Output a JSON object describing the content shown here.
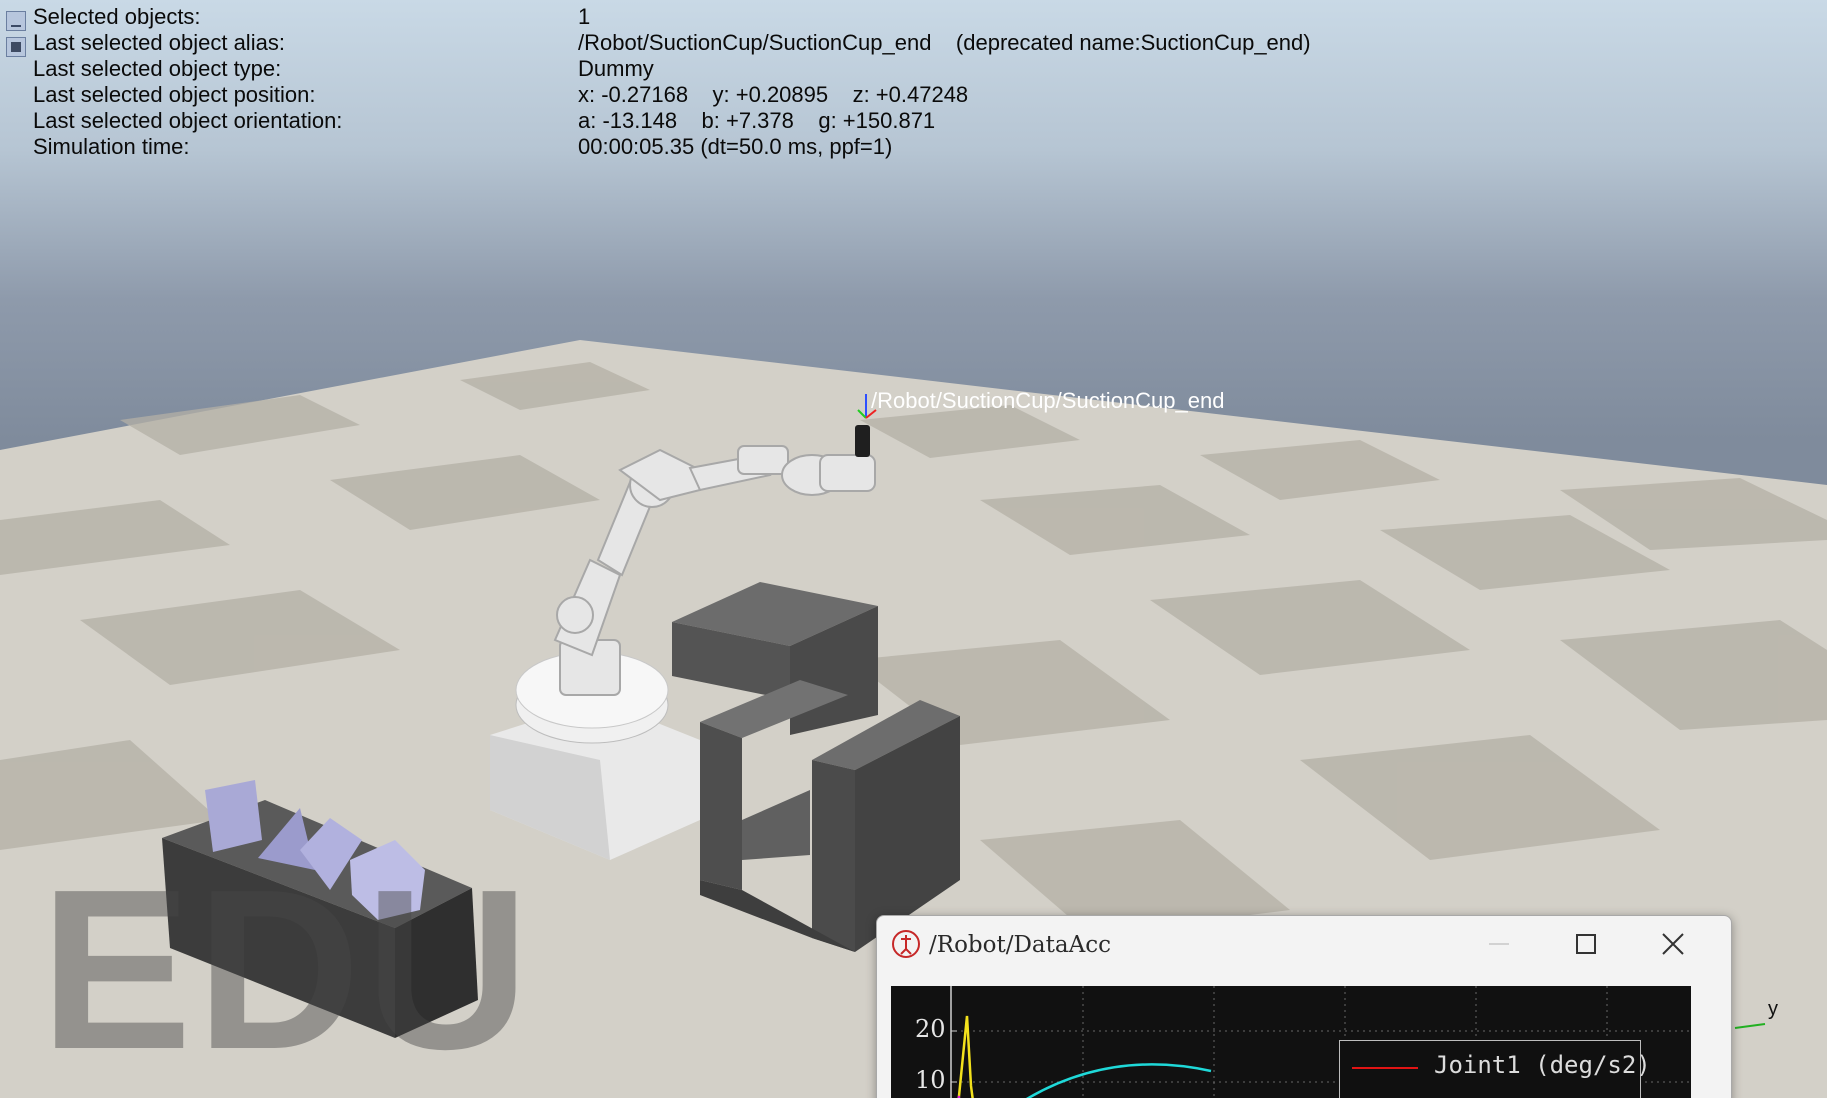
{
  "info_panel": {
    "rows": [
      {
        "label": "Selected objects:",
        "value": "1"
      },
      {
        "label": "Last selected object alias:",
        "value": "/Robot/SuctionCup/SuctionCup_end    (deprecated name:SuctionCup_end)"
      },
      {
        "label": "Last selected object type:",
        "value": "Dummy"
      },
      {
        "label": "Last selected object position:",
        "value": "x: -0.27168    y: +0.20895    z: +0.47248"
      },
      {
        "label": "Last selected object orientation:",
        "value": "a: -13.148    b: +7.378    g: +150.871"
      },
      {
        "label": "Simulation time:",
        "value": "00:00:05.35 (dt=50.0 ms, ppf=1)"
      }
    ]
  },
  "scene": {
    "object_label": "/Robot/SuctionCup/SuctionCup_end",
    "watermark": "EDU",
    "axis_label": "y"
  },
  "graph_window": {
    "title": "/Robot/DataAcc",
    "y_ticks": [
      "20",
      "10"
    ],
    "legend_entry": "Joint1 (deg/s2)",
    "legend_color": "#e11414"
  }
}
